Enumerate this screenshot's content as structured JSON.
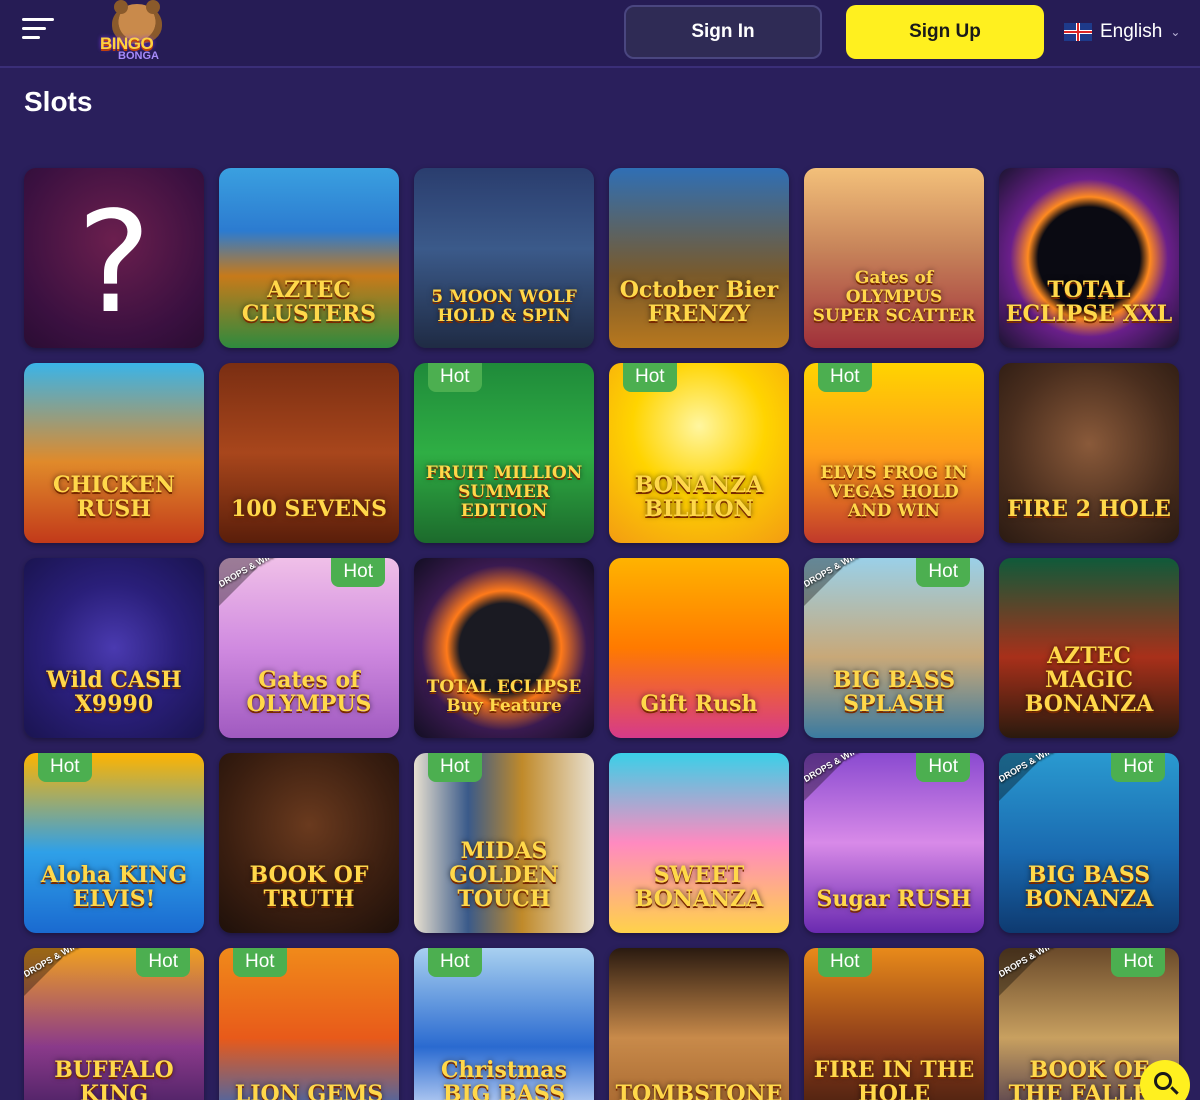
{
  "header": {
    "signin_label": "Sign In",
    "signup_label": "Sign Up",
    "language": "English",
    "logo_text_1": "BINGO",
    "logo_text_2": "BONGA"
  },
  "page": {
    "title": "Slots"
  },
  "hot_label": "Hot",
  "drops_label": "DROPS & WINS",
  "colors": {
    "accent": "#fff01f",
    "hot": "#4caf50",
    "background": "#2a1f5c"
  },
  "games": [
    {
      "title": "",
      "hot": false,
      "drops": false
    },
    {
      "title": "AZTEC CLUSTERS",
      "hot": false,
      "drops": false
    },
    {
      "title": "5 MOON WOLF HOLD & SPIN",
      "hot": false,
      "drops": false
    },
    {
      "title": "October Bier FRENZY",
      "hot": false,
      "drops": false
    },
    {
      "title": "Gates of OLYMPUS SUPER SCATTER",
      "hot": false,
      "drops": false
    },
    {
      "title": "TOTAL ECLIPSE XXL",
      "hot": false,
      "drops": false
    },
    {
      "title": "CHICKEN RUSH",
      "hot": false,
      "drops": false
    },
    {
      "title": "100 SEVENS",
      "hot": false,
      "drops": false
    },
    {
      "title": "FRUIT MILLION SUMMER EDITION",
      "hot": true,
      "drops": false
    },
    {
      "title": "BONANZA BILLION",
      "hot": true,
      "drops": false
    },
    {
      "title": "ELVIS FROG IN VEGAS HOLD AND WIN",
      "hot": true,
      "drops": false
    },
    {
      "title": "FIRE 2 HOLE",
      "hot": false,
      "drops": false
    },
    {
      "title": "Wild CASH X9990",
      "hot": false,
      "drops": false
    },
    {
      "title": "Gates of OLYMPUS",
      "hot": true,
      "drops": true
    },
    {
      "title": "TOTAL ECLIPSE Buy Feature",
      "hot": false,
      "drops": false
    },
    {
      "title": "Gift Rush",
      "hot": false,
      "drops": false
    },
    {
      "title": "BIG BASS SPLASH",
      "hot": true,
      "drops": true
    },
    {
      "title": "AZTEC MAGIC BONANZA",
      "hot": false,
      "drops": false
    },
    {
      "title": "Aloha KING ELVIS!",
      "hot": true,
      "drops": false
    },
    {
      "title": "BOOK OF TRUTH",
      "hot": false,
      "drops": false
    },
    {
      "title": "MIDAS GOLDEN TOUCH",
      "hot": true,
      "drops": false
    },
    {
      "title": "SWEET BONANZA",
      "hot": false,
      "drops": false
    },
    {
      "title": "Sugar RUSH",
      "hot": true,
      "drops": true
    },
    {
      "title": "BIG BASS BONANZA",
      "hot": true,
      "drops": true
    },
    {
      "title": "BUFFALO KING",
      "hot": true,
      "drops": true
    },
    {
      "title": "LION GEMS",
      "hot": true,
      "drops": false
    },
    {
      "title": "Christmas BIG BASS",
      "hot": true,
      "drops": false
    },
    {
      "title": "TOMBSTONE",
      "hot": false,
      "drops": false
    },
    {
      "title": "FIRE IN THE HOLE",
      "hot": true,
      "drops": false
    },
    {
      "title": "BOOK OF THE FALLEN",
      "hot": true,
      "drops": true
    }
  ]
}
